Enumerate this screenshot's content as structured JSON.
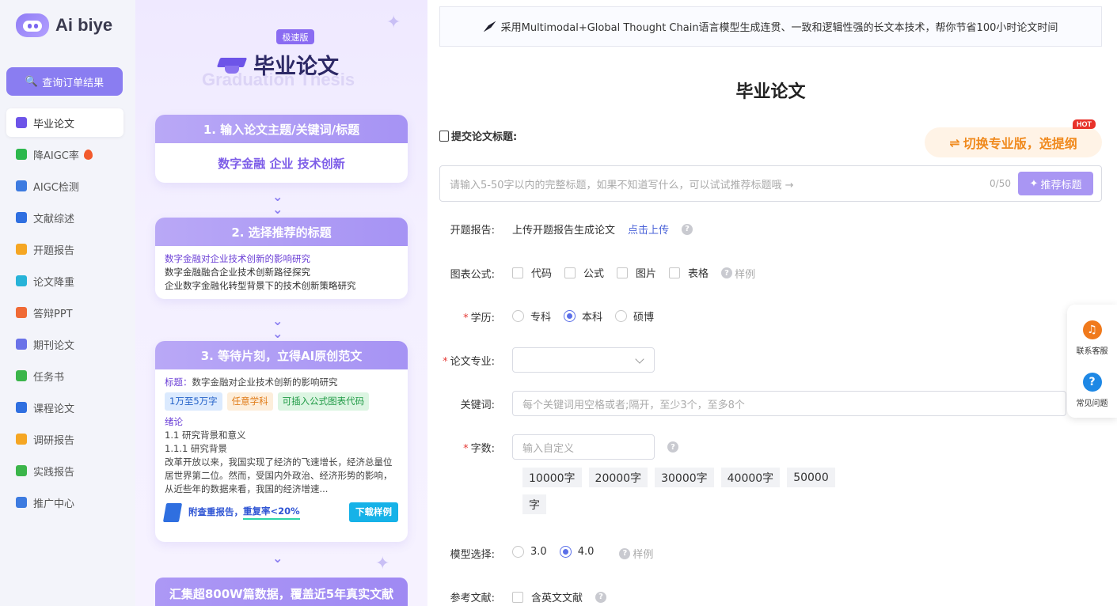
{
  "app": {
    "brand": "Ai biye"
  },
  "sidebar": {
    "query_button": "查询订单结果",
    "items": [
      {
        "label": "毕业论文",
        "icon": "graduation-cap-icon",
        "color": "#6d54e8",
        "active": true
      },
      {
        "label": "降AIGC率",
        "icon": "ai-icon",
        "color": "#2db84d"
      },
      {
        "label": "AIGC检测",
        "icon": "ai-detect-icon",
        "color": "#3d7be0"
      },
      {
        "label": "文献综述",
        "icon": "book-icon",
        "color": "#2f6fe0"
      },
      {
        "label": "开题报告",
        "icon": "report-icon",
        "color": "#f5a623"
      },
      {
        "label": "论文降重",
        "icon": "chart-icon",
        "color": "#27b3d8"
      },
      {
        "label": "答辩PPT",
        "icon": "ppt-icon",
        "color": "#f06a35"
      },
      {
        "label": "期刊论文",
        "icon": "journal-icon",
        "color": "#6a72e8"
      },
      {
        "label": "任务书",
        "icon": "task-icon",
        "color": "#3bb54a"
      },
      {
        "label": "课程论文",
        "icon": "course-icon",
        "color": "#2f6fe0"
      },
      {
        "label": "调研报告",
        "icon": "survey-icon",
        "color": "#f5a623"
      },
      {
        "label": "实践报告",
        "icon": "practice-icon",
        "color": "#3bb54a"
      },
      {
        "label": "推广中心",
        "icon": "send-icon",
        "color": "#3d7be0"
      }
    ]
  },
  "promo": {
    "badge": "极速版",
    "title": "毕业论文",
    "subtitle": "Graduation Thesis",
    "step1": {
      "title": "1. 输入论文主题/关键词/标题",
      "keywords": "数字金融 企业 技术创新"
    },
    "step2": {
      "title": "2. 选择推荐的标题",
      "titles": [
        "数字金融对企业技术创新的影响研究",
        "数字金融融合企业技术创新路径探究",
        "企业数字金融化转型背景下的技术创新策略研究"
      ]
    },
    "step3": {
      "title": "3. 等待片刻，立得AI原创范文",
      "paper_title_label": "标题：",
      "paper_title": "数字金融对企业技术创新的影响研究",
      "tags": [
        {
          "text": "1万至5万字",
          "bg": "#dbeafe",
          "fg": "#2563c9"
        },
        {
          "text": "任意学科",
          "bg": "#fdeedb",
          "fg": "#e07b17"
        },
        {
          "text": "可插入公式图表代码",
          "bg": "#dcf5e2",
          "fg": "#1f9a45"
        }
      ],
      "intro": "绪论",
      "s1": "1.1 研究背景和意义",
      "s2": "1.1.1 研究背景",
      "body": "改革开放以来，我国实现了经济的飞速增长，经济总量位居世界第二位。然而，受国内外政治、经济形势的影响，从近些年的数据来看，我国的经济增速...",
      "footer_left": "附查重报告，",
      "footer_rate": "重复率<20%",
      "download": "下载样例"
    },
    "banner": "汇集超800W篇数据，覆盖近5年真实文献"
  },
  "main": {
    "notice": "采用Multimodal+Global Thought Chain语言模型生成连贯、一致和逻辑性强的长文本技术，帮你节省100小时论文时间",
    "title": "毕业论文",
    "submit_label": "提交论文标题:",
    "switch_button": "切换专业版，选提纲",
    "hot": "HOT",
    "title_placeholder": "请输入5-50字以内的完整标题，如果不知道写什么，可以试试推荐标题哦 →",
    "counter": "0/50",
    "recommend_button": "推荐标题",
    "opening": {
      "label": "开题报告:",
      "text": "上传开题报告生成论文",
      "link": "点击上传"
    },
    "charts": {
      "label": "图表公式:",
      "options": [
        "代码",
        "公式",
        "图片",
        "表格"
      ],
      "sample": "样例"
    },
    "degree": {
      "label": "学历:",
      "options": [
        "专科",
        "本科",
        "硕博"
      ],
      "selected": "本科"
    },
    "major": {
      "label": "论文专业:"
    },
    "keywords": {
      "label": "关键词:",
      "placeholder": "每个关键词用空格或者;隔开，至少3个，至多8个"
    },
    "words": {
      "label": "字数:",
      "placeholder": "输入自定义",
      "options": [
        "10000字",
        "20000字",
        "30000字",
        "40000字",
        "50000"
      ],
      "wrap": "字"
    },
    "model": {
      "label": "模型选择:",
      "options": [
        "3.0",
        "4.0"
      ],
      "selected": "4.0",
      "sample": "样例"
    },
    "refs": {
      "label": "参考文献:",
      "option": "含英文文献"
    }
  },
  "float": {
    "service": "联系客服",
    "faq": "常见问题"
  }
}
